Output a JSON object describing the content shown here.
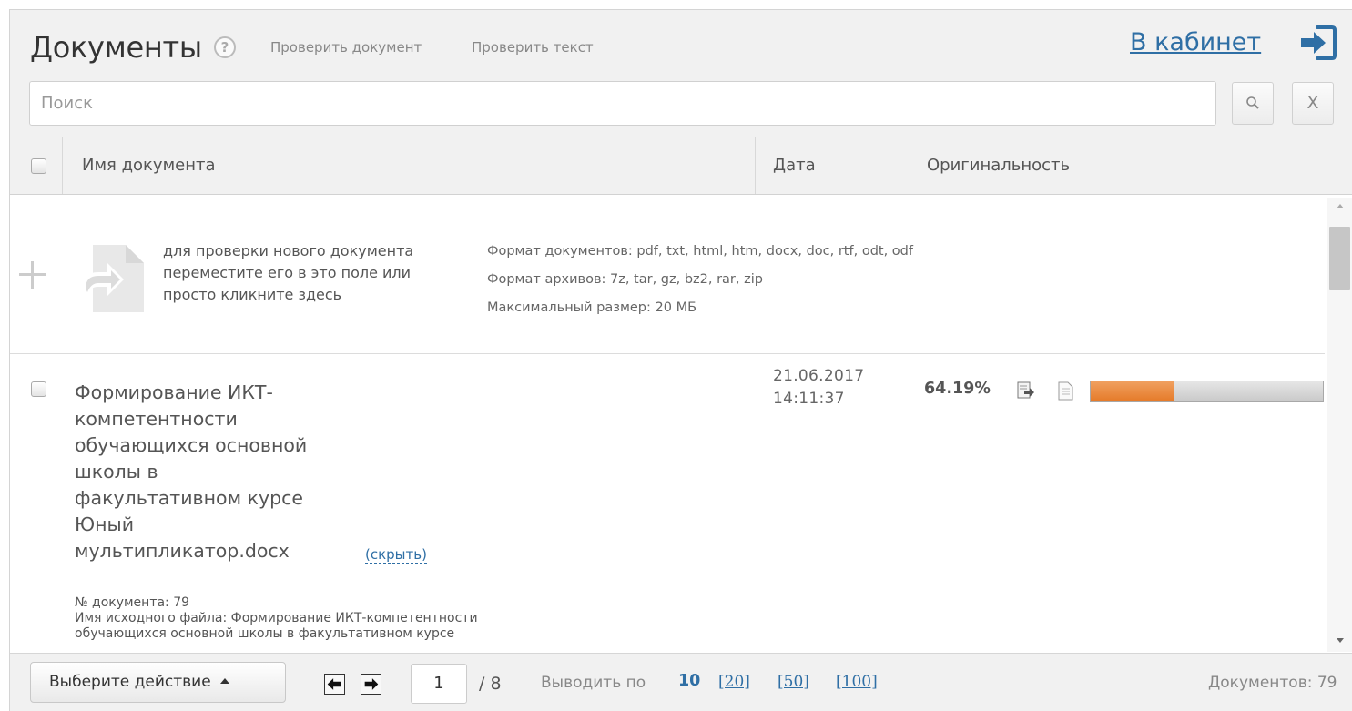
{
  "header": {
    "title": "Документы",
    "help_label": "?",
    "check_document_label": "Проверить документ",
    "check_text_label": "Проверить текст",
    "cabinet_label": "В кабинет"
  },
  "search": {
    "placeholder": "Поиск",
    "search_icon": "search-icon",
    "clear_label": "X"
  },
  "table": {
    "columns": {
      "name": "Имя документа",
      "date": "Дата",
      "originality": "Оригинальность"
    }
  },
  "upload": {
    "hint_line1": "для проверки нового документа",
    "hint_line2": "переместите его в это поле или",
    "hint_line3": "просто кликните здесь",
    "doc_formats": "Формат документов: pdf, txt, html, htm, docx, doc, rtf, odt, odf",
    "archive_formats": "Формат архивов: 7z, tar, gz, bz2, rar, zip",
    "max_size": "Максимальный размер: 20 МБ"
  },
  "documents": [
    {
      "name_lines": [
        "Формирование ИКТ-",
        "компетентности",
        "обучающихся основной",
        "школы в",
        "факультативном курсе",
        "Юный",
        "мультипликатор.docx"
      ],
      "hide_label": "(скрыть)",
      "meta_line1": "№ документа: 79",
      "meta_line2": "Имя исходного файла: Формирование ИКТ-компетентности",
      "meta_line3": "обучающихся основной школы в факультативном курсе",
      "date": "21.06.2017",
      "time": "14:11:37",
      "originality": "64.19%",
      "originality_bar_fraction": 0.3581
    }
  ],
  "footer": {
    "action_label": "Выберите действие",
    "current_page": "1",
    "total_pages": "/ 8",
    "per_page_label": "Выводить по",
    "per_page_current": "10",
    "per_page_options": [
      "[20]",
      "[50]",
      "[100]"
    ],
    "doc_count": "Документов: 79"
  },
  "colors": {
    "accent": "#2f6fa5",
    "bar_fill": "#e57a28",
    "bar_bg": "#d4d4d4"
  }
}
